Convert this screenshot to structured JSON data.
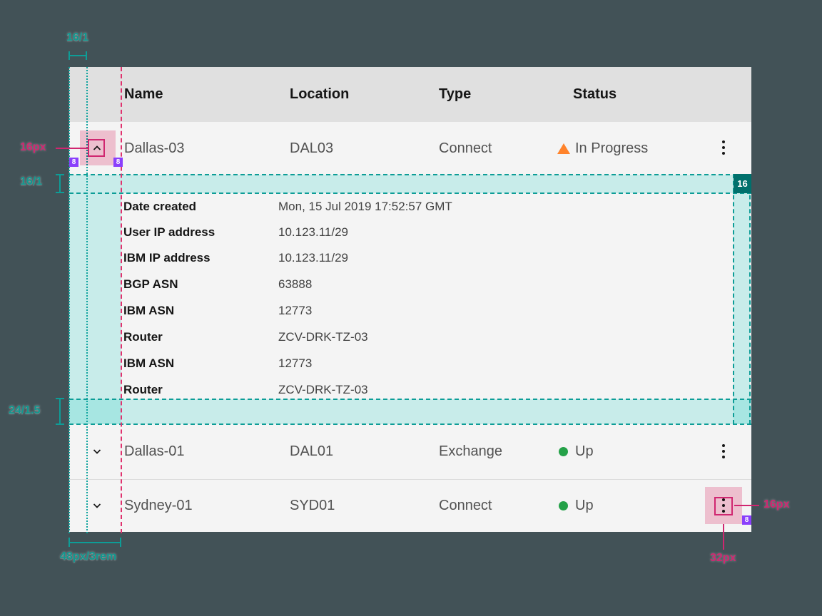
{
  "table": {
    "headers": [
      "Name",
      "Location",
      "Type",
      "Status"
    ],
    "rows": [
      {
        "name": "Dallas-03",
        "location": "DAL03",
        "type": "Connect",
        "status": "In Progress",
        "status_kind": "warning",
        "expanded": true
      },
      {
        "name": "Dallas-01",
        "location": "DAL01",
        "type": "Exchange",
        "status": "Up",
        "status_kind": "ok",
        "expanded": false
      },
      {
        "name": "Sydney-01",
        "location": "SYD01",
        "type": "Connect",
        "status": "Up",
        "status_kind": "ok",
        "expanded": false
      }
    ],
    "expanded_details": [
      {
        "label": "Date created",
        "value": "Mon, 15 Jul 2019 17:52:57 GMT"
      },
      {
        "label": "User IP address",
        "value": "10.123.11/29"
      },
      {
        "label": "IBM IP address",
        "value": "10.123.11/29"
      },
      {
        "label": "BGP ASN",
        "value": "63888"
      },
      {
        "label": "IBM ASN",
        "value": "12773"
      },
      {
        "label": "Router",
        "value": "ZCV-DRK-TZ-03"
      },
      {
        "label": "IBM ASN",
        "value": "12773"
      },
      {
        "label": "Router",
        "value": "ZCV-DRK-TZ-03"
      }
    ]
  },
  "annotations": {
    "top_gutter": "16/1",
    "expand_icon_size": "16px",
    "expand_pad_left": "8",
    "expand_pad_right": "8",
    "expanded_top_padding": "16/1",
    "expanded_top_badge": "16",
    "expanded_bottom_padding": "24/1.5",
    "expand_column_width": "48px/3rem",
    "overflow_icon_size": "16px",
    "overflow_pad": "8",
    "overflow_target_size": "32px"
  },
  "colors": {
    "annotation_teal": "#0d9d97",
    "annotation_magenta": "#d02670",
    "badge_purple": "#8a3ffc",
    "badge_teal": "#00706c",
    "status_warning": "#ff832b",
    "status_ok": "#24a148",
    "highlight_cyan": "#c4efec",
    "highlight_pink": "#f8c8d8",
    "header_bg": "#e0e0e0",
    "row_bg": "#f4f4f4"
  }
}
